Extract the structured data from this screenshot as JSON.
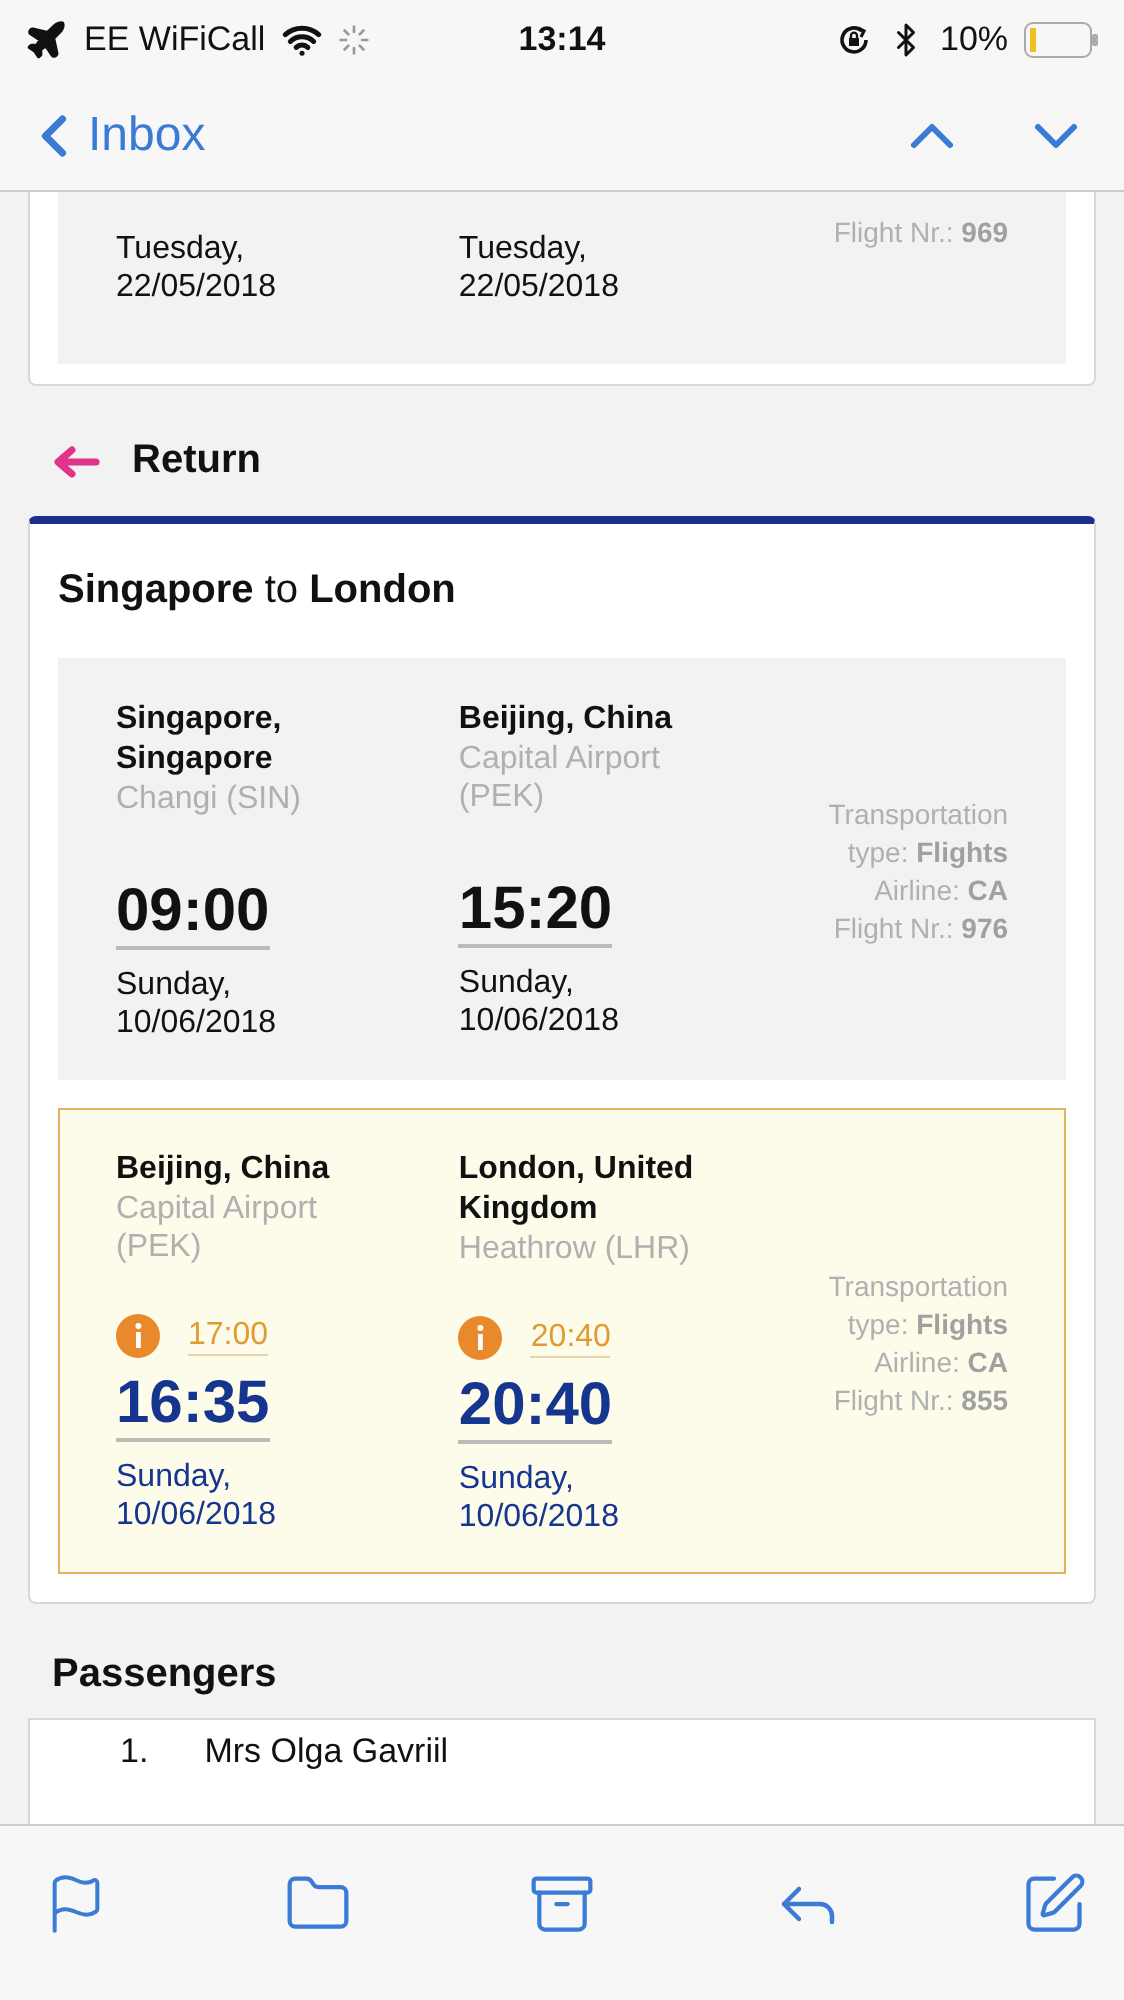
{
  "status_bar": {
    "carrier": "EE WiFiCall",
    "time": "13:14",
    "battery": "10%"
  },
  "nav": {
    "back": "Inbox"
  },
  "previous_segment": {
    "dates": [
      "Tuesday,\n22/05/2018",
      "Tuesday,\n22/05/2018"
    ],
    "details": [
      "Flight Nr.: **969**"
    ]
  },
  "return": {
    "heading": "Return",
    "title": "**Singapore** to **London**",
    "segments": [
      {
        "kind": "normal",
        "from": {
          "city": "Singapore, Singapore",
          "airport": "Changi (SIN)",
          "time": "09:00",
          "date": "Sunday,\n10/06/2018"
        },
        "to": {
          "city": "Beijing, China",
          "airport": "Capital Airport (PEK)",
          "time": "15:20",
          "date": "Sunday,\n10/06/2018"
        },
        "details": [
          "Transportation type: **Flights**",
          "Airline: **CA**",
          "Flight Nr.: **976**"
        ]
      },
      {
        "kind": "changed",
        "from": {
          "city": "Beijing, China",
          "airport": "Capital Airport (PEK)",
          "original_time": "17:00",
          "time": "16:35",
          "date": "Sunday,\n10/06/2018"
        },
        "to": {
          "city": "London, United Kingdom",
          "airport": "Heathrow (LHR)",
          "original_time": "20:40",
          "time": "20:40",
          "date": "Sunday,\n10/06/2018"
        },
        "details": [
          "Transportation type: **Flights**",
          "Airline: **CA**",
          "Flight Nr.: **855**"
        ]
      }
    ]
  },
  "passengers": {
    "heading": "Passengers",
    "items": [
      {
        "number": "1.",
        "name": "Mrs Olga Gavriil"
      }
    ]
  }
}
